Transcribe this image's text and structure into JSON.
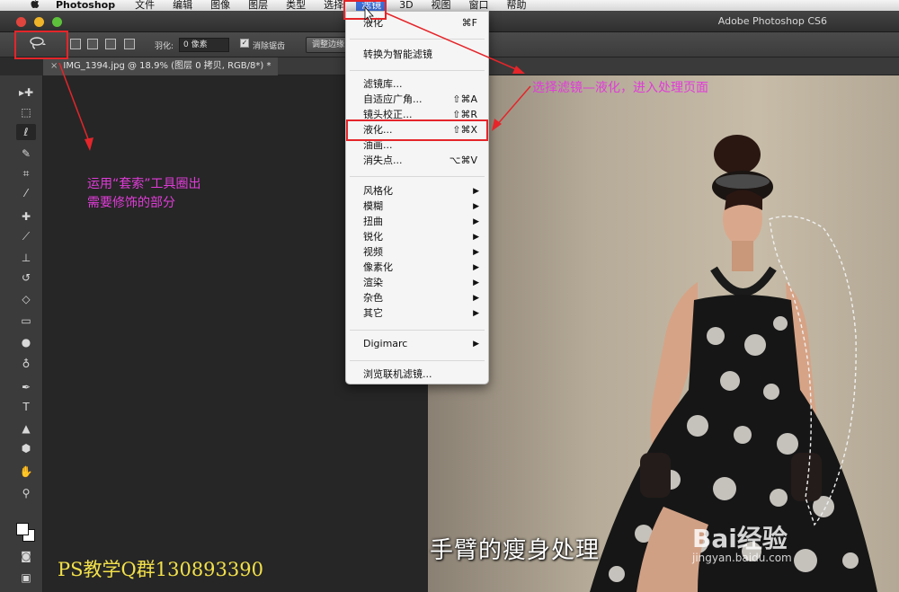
{
  "menubar": {
    "apple": "",
    "app": "Photoshop",
    "items": [
      "文件",
      "编辑",
      "图像",
      "图层",
      "类型",
      "选择",
      "滤镜",
      "3D",
      "视图",
      "窗口",
      "帮助"
    ]
  },
  "window": {
    "title": "Adobe Photoshop CS6"
  },
  "options": {
    "feather_label": "羽化:",
    "feather_value": "0 像素",
    "antialias_label": "消除锯齿",
    "refine_button": "调整边缘..."
  },
  "document": {
    "tab_title": "IMG_1394.jpg @ 18.9% (图层 0 拷贝, RGB/8*) *",
    "close": "×"
  },
  "filter_menu": {
    "items": [
      {
        "label": "液化",
        "shortcut": "⌘F"
      },
      {
        "label": "转换为智能滤镜",
        "shortcut": ""
      },
      {
        "label": "滤镜库...",
        "shortcut": ""
      },
      {
        "label": "自适应广角...",
        "shortcut": "⇧⌘A"
      },
      {
        "label": "镜头校正...",
        "shortcut": "⇧⌘R"
      },
      {
        "label": "液化...",
        "shortcut": "⇧⌘X"
      },
      {
        "label": "油画...",
        "shortcut": ""
      },
      {
        "label": "消失点...",
        "shortcut": "⌥⌘V"
      },
      {
        "label": "风格化",
        "shortcut": "▶"
      },
      {
        "label": "模糊",
        "shortcut": "▶"
      },
      {
        "label": "扭曲",
        "shortcut": "▶"
      },
      {
        "label": "锐化",
        "shortcut": "▶"
      },
      {
        "label": "视频",
        "shortcut": "▶"
      },
      {
        "label": "像素化",
        "shortcut": "▶"
      },
      {
        "label": "渲染",
        "shortcut": "▶"
      },
      {
        "label": "杂色",
        "shortcut": "▶"
      },
      {
        "label": "其它",
        "shortcut": "▶"
      },
      {
        "label": "Digimarc",
        "shortcut": "▶"
      },
      {
        "label": "浏览联机滤镜...",
        "shortcut": ""
      }
    ]
  },
  "annotations": {
    "lasso_line1": "运用“套索”工具圈出",
    "lasso_line2": "需要修饰的部分",
    "menu_note": "选择滤镜—液化，进入处理页面",
    "qq_group": "PS教学Q群130893390",
    "subtitle": "手臂的瘦身处理",
    "watermark": "Bai经验",
    "watermark_url": "jingyan.baidu.com"
  },
  "colors": {
    "annotation": "#e03cd8",
    "highlight": "#e5252a",
    "menu_active": "#3d6fd8",
    "qq_text": "#f2e04a"
  },
  "icons": [
    "apple-icon",
    "lasso-icon",
    "move-icon",
    "marquee-icon",
    "crop-icon",
    "eyedropper-icon",
    "brush-icon",
    "stamp-icon",
    "eraser-icon",
    "gradient-icon",
    "pen-icon",
    "type-icon",
    "hand-icon",
    "zoom-icon"
  ]
}
